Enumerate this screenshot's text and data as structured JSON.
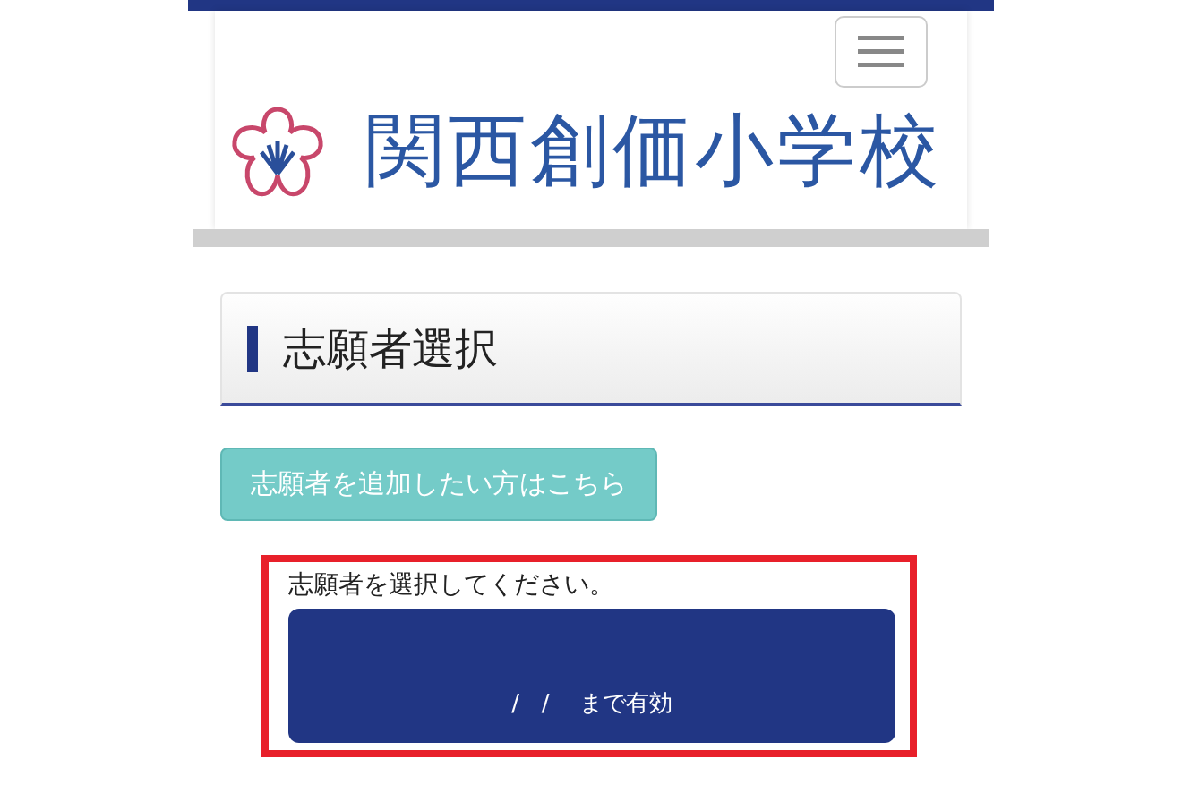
{
  "header": {
    "logo_text": "関西創価小学校"
  },
  "page_heading": "志願者選択",
  "add_button": "志願者を追加したい方はこちら",
  "selection": {
    "prompt": "志願者を選択してください。",
    "applicants": [
      {
        "validity": "/   /    まで有効"
      }
    ]
  }
}
